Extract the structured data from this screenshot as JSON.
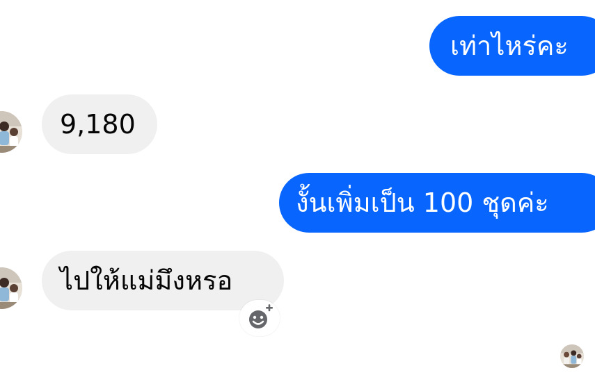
{
  "messages": [
    {
      "direction": "outgoing",
      "text": "เท่าไหร่คะ"
    },
    {
      "direction": "incoming",
      "text": "9,180"
    },
    {
      "direction": "outgoing",
      "text": "งั้นเพิ่มเป็น 100 ชุดค่ะ"
    },
    {
      "direction": "incoming",
      "text": "ไปให้แม่มึงหรอ"
    }
  ],
  "colors": {
    "outgoing_bubble": "#0866ff",
    "incoming_bubble": "#f0f0f0",
    "outgoing_text": "#ffffff",
    "incoming_text": "#050505"
  },
  "icons": {
    "reaction": "add-reaction-icon",
    "avatar": "contact-avatar",
    "seen": "seen-avatar"
  }
}
